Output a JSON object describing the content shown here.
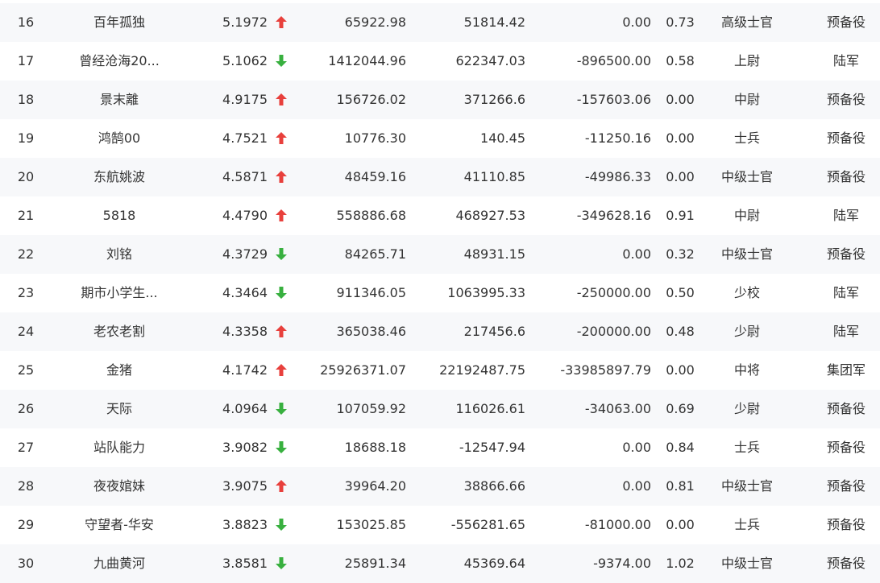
{
  "colors": {
    "up": "#e8403c",
    "down": "#38b03f",
    "text": "#333333",
    "row_alt": "#f7f8fa"
  },
  "rows": [
    {
      "rank": "16",
      "name": "百年孤独",
      "score": "5.1972",
      "trend": "up",
      "v1": "65922.98",
      "v2": "51814.42",
      "v3": "0.00",
      "ratio": "0.73",
      "level": "高级士官",
      "unit": "预备役"
    },
    {
      "rank": "17",
      "name": "曾经沧海20...",
      "score": "5.1062",
      "trend": "down",
      "v1": "1412044.96",
      "v2": "622347.03",
      "v3": "-896500.00",
      "ratio": "0.58",
      "level": "上尉",
      "unit": "陆军"
    },
    {
      "rank": "18",
      "name": "景末離",
      "score": "4.9175",
      "trend": "up",
      "v1": "156726.02",
      "v2": "371266.6",
      "v3": "-157603.06",
      "ratio": "0.00",
      "level": "中尉",
      "unit": "预备役"
    },
    {
      "rank": "19",
      "name": "鸿鹄00",
      "score": "4.7521",
      "trend": "up",
      "v1": "10776.30",
      "v2": "140.45",
      "v3": "-11250.16",
      "ratio": "0.00",
      "level": "士兵",
      "unit": "预备役"
    },
    {
      "rank": "20",
      "name": "东航姚波",
      "score": "4.5871",
      "trend": "up",
      "v1": "48459.16",
      "v2": "41110.85",
      "v3": "-49986.33",
      "ratio": "0.00",
      "level": "中级士官",
      "unit": "预备役"
    },
    {
      "rank": "21",
      "name": "5818",
      "score": "4.4790",
      "trend": "up",
      "v1": "558886.68",
      "v2": "468927.53",
      "v3": "-349628.16",
      "ratio": "0.91",
      "level": "中尉",
      "unit": "陆军"
    },
    {
      "rank": "22",
      "name": "刘铭",
      "score": "4.3729",
      "trend": "down",
      "v1": "84265.71",
      "v2": "48931.15",
      "v3": "0.00",
      "ratio": "0.32",
      "level": "中级士官",
      "unit": "预备役"
    },
    {
      "rank": "23",
      "name": "期市小学生...",
      "score": "4.3464",
      "trend": "down",
      "v1": "911346.05",
      "v2": "1063995.33",
      "v3": "-250000.00",
      "ratio": "0.50",
      "level": "少校",
      "unit": "陆军"
    },
    {
      "rank": "24",
      "name": "老农老割",
      "score": "4.3358",
      "trend": "up",
      "v1": "365038.46",
      "v2": "217456.6",
      "v3": "-200000.00",
      "ratio": "0.48",
      "level": "少尉",
      "unit": "陆军"
    },
    {
      "rank": "25",
      "name": "金猪",
      "score": "4.1742",
      "trend": "up",
      "v1": "25926371.07",
      "v2": "22192487.75",
      "v3": "-33985897.79",
      "ratio": "0.00",
      "level": "中将",
      "unit": "集团军"
    },
    {
      "rank": "26",
      "name": "天际",
      "score": "4.0964",
      "trend": "down",
      "v1": "107059.92",
      "v2": "116026.61",
      "v3": "-34063.00",
      "ratio": "0.69",
      "level": "少尉",
      "unit": "预备役"
    },
    {
      "rank": "27",
      "name": "站队能力",
      "score": "3.9082",
      "trend": "down",
      "v1": "18688.18",
      "v2": "-12547.94",
      "v3": "0.00",
      "ratio": "0.84",
      "level": "士兵",
      "unit": "预备役"
    },
    {
      "rank": "28",
      "name": "夜夜婠妹",
      "score": "3.9075",
      "trend": "up",
      "v1": "39964.20",
      "v2": "38866.66",
      "v3": "0.00",
      "ratio": "0.81",
      "level": "中级士官",
      "unit": "预备役"
    },
    {
      "rank": "29",
      "name": "守望者-华安",
      "score": "3.8823",
      "trend": "down",
      "v1": "153025.85",
      "v2": "-556281.65",
      "v3": "-81000.00",
      "ratio": "0.00",
      "level": "士兵",
      "unit": "预备役"
    },
    {
      "rank": "30",
      "name": "九曲黄河",
      "score": "3.8581",
      "trend": "down",
      "v1": "25891.34",
      "v2": "45369.64",
      "v3": "-9374.00",
      "ratio": "1.02",
      "level": "中级士官",
      "unit": "预备役"
    }
  ]
}
